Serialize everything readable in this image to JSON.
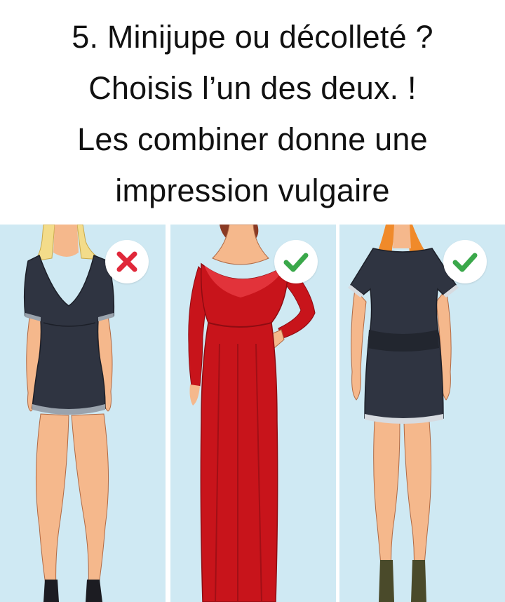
{
  "caption": {
    "lines": [
      "5. Minijupe ou décolleté ?",
      "Choisis l’un des deux. !",
      "Les combiner donne une",
      "impression vulgaire"
    ]
  },
  "panels": [
    {
      "verdict": "incorrect",
      "icon": "cross-icon",
      "badge_color": "#e0283a",
      "dress_color": "#2f3441",
      "hair_color": "#f3dc8a"
    },
    {
      "verdict": "correct",
      "icon": "check-icon",
      "badge_color": "#3aa84a",
      "dress_color": "#c8141b",
      "hair_color": "#8a3a24"
    },
    {
      "verdict": "correct",
      "icon": "check-icon",
      "badge_color": "#3aa84a",
      "dress_color": "#2f3441",
      "hair_color": "#f08a2a"
    }
  ],
  "colors": {
    "panel_background": "#cfe9f3",
    "skin": "#f5b88c"
  }
}
